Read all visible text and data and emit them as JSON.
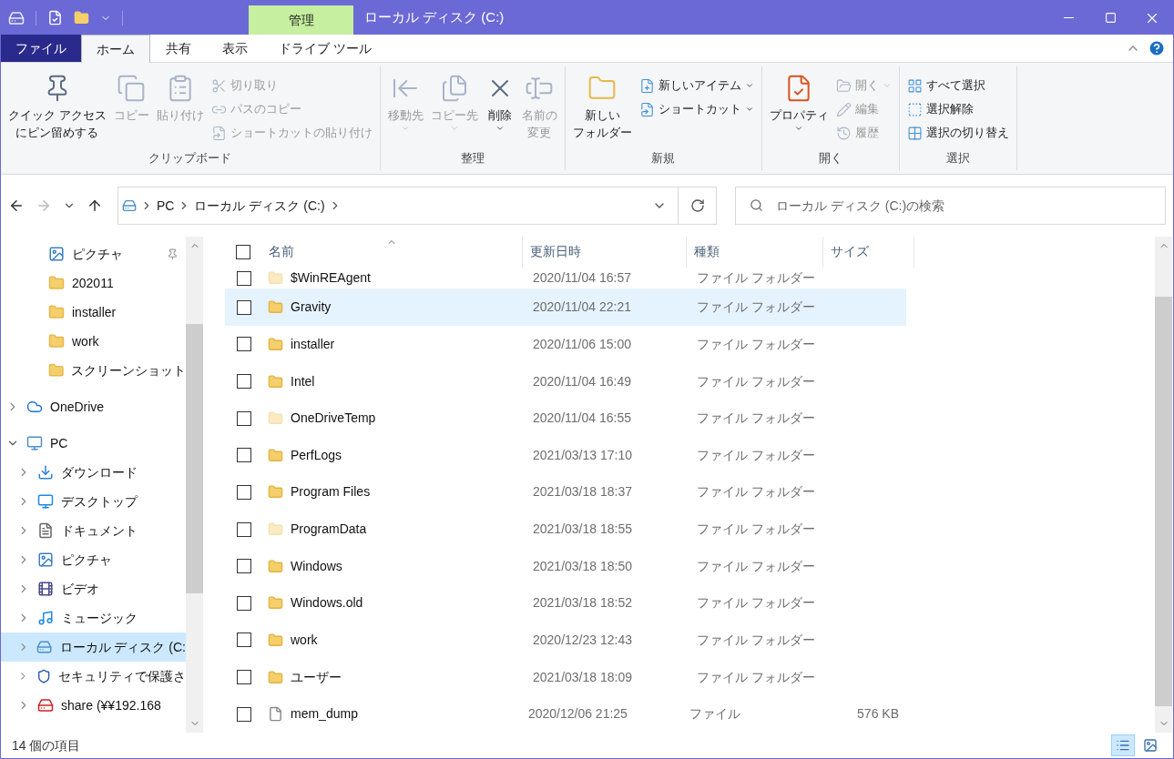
{
  "window": {
    "title": "ローカル ディスク (C:)"
  },
  "ribbon_tabs": [
    {
      "label": "ファイル",
      "kind": "file",
      "selected": false
    },
    {
      "label": "ホーム",
      "kind": "tab",
      "selected": true
    },
    {
      "label": "共有",
      "kind": "tab",
      "selected": false
    },
    {
      "label": "表示",
      "kind": "tab",
      "selected": false
    },
    {
      "label": "ドライブ ツール",
      "kind": "context",
      "context_label": "管理",
      "selected": false
    }
  ],
  "ribbon_groups": [
    {
      "name": "クリップボード",
      "items": [
        {
          "kind": "large",
          "lines": [
            "クイック アクセス",
            "にピン留めする"
          ],
          "disabled": false,
          "dropdown": false
        },
        {
          "kind": "large",
          "lines": [
            "コピー"
          ],
          "disabled": true,
          "dropdown": false
        },
        {
          "kind": "large",
          "lines": [
            "貼り付け"
          ],
          "disabled": true,
          "dropdown": false
        },
        {
          "kind": "small",
          "lines": [
            "切り取り"
          ],
          "disabled": true,
          "dropdown": false
        },
        {
          "kind": "small",
          "lines": [
            "パスのコピー"
          ],
          "disabled": true,
          "dropdown": false
        },
        {
          "kind": "small",
          "lines": [
            "ショートカットの貼り付け"
          ],
          "disabled": true,
          "dropdown": false
        }
      ]
    },
    {
      "name": "整理",
      "items": [
        {
          "kind": "large",
          "lines": [
            "移動先"
          ],
          "disabled": true,
          "dropdown": true
        },
        {
          "kind": "large",
          "lines": [
            "コピー先"
          ],
          "disabled": true,
          "dropdown": true
        },
        {
          "kind": "large",
          "lines": [
            "削除"
          ],
          "disabled": false,
          "dropdown": true
        },
        {
          "kind": "large",
          "lines": [
            "名前の",
            "変更"
          ],
          "disabled": true,
          "dropdown": false
        }
      ]
    },
    {
      "name": "新規",
      "items": [
        {
          "kind": "large",
          "lines": [
            "新しい",
            "フォルダー"
          ],
          "disabled": false,
          "dropdown": false
        },
        {
          "kind": "small",
          "lines": [
            "新しいアイテム"
          ],
          "disabled": false,
          "dropdown": true
        },
        {
          "kind": "small",
          "lines": [
            "ショートカット"
          ],
          "disabled": false,
          "dropdown": true
        }
      ]
    },
    {
      "name": "開く",
      "items": [
        {
          "kind": "large",
          "lines": [
            "プロパティ"
          ],
          "disabled": false,
          "dropdown": true
        },
        {
          "kind": "small",
          "lines": [
            "開く"
          ],
          "disabled": true,
          "dropdown": true
        },
        {
          "kind": "small",
          "lines": [
            "編集"
          ],
          "disabled": true,
          "dropdown": false
        },
        {
          "kind": "small",
          "lines": [
            "履歴"
          ],
          "disabled": true,
          "dropdown": false
        }
      ]
    },
    {
      "name": "選択",
      "items": [
        {
          "kind": "small",
          "lines": [
            "すべて選択"
          ],
          "disabled": false,
          "dropdown": false
        },
        {
          "kind": "small",
          "lines": [
            "選択解除"
          ],
          "disabled": false,
          "dropdown": false
        },
        {
          "kind": "small",
          "lines": [
            "選択の切り替え"
          ],
          "disabled": false,
          "dropdown": false
        }
      ]
    }
  ],
  "address": {
    "crumbs": [
      "PC",
      "ローカル ディスク (C:)"
    ]
  },
  "search": {
    "placeholder": "ローカル ディスク (C:)の検索"
  },
  "sidebar": {
    "quick_access": [
      {
        "label": "ピクチャ",
        "pinned": true
      },
      {
        "label": "202011",
        "pinned": false
      },
      {
        "label": "installer",
        "pinned": false
      },
      {
        "label": "work",
        "pinned": false
      },
      {
        "label": "スクリーンショット",
        "pinned": false
      }
    ],
    "tree": [
      {
        "label": "OneDrive",
        "expanded": false,
        "selected": false
      },
      {
        "label": "PC",
        "expanded": true,
        "selected": false,
        "children": [
          {
            "label": "ダウンロード",
            "expanded": false,
            "selected": false
          },
          {
            "label": "デスクトップ",
            "expanded": false,
            "selected": false
          },
          {
            "label": "ドキュメント",
            "expanded": false,
            "selected": false
          },
          {
            "label": "ピクチャ",
            "expanded": false,
            "selected": false
          },
          {
            "label": "ビデオ",
            "expanded": false,
            "selected": false
          },
          {
            "label": "ミュージック",
            "expanded": false,
            "selected": false
          },
          {
            "label": "ローカル ディスク (C:",
            "expanded": false,
            "selected": true
          },
          {
            "label": "セキュリティで保護さ",
            "expanded": false,
            "selected": false
          },
          {
            "label": "share (¥¥192.168",
            "expanded": false,
            "selected": false
          }
        ]
      }
    ]
  },
  "table": {
    "all_checked": false,
    "columns": [
      {
        "label": "名前",
        "sorted": true
      },
      {
        "label": "更新日時",
        "sorted": false
      },
      {
        "label": "種類",
        "sorted": false
      },
      {
        "label": "サイズ",
        "sorted": false
      }
    ],
    "rows": [
      {
        "name": "$WinREAgent",
        "date": "2020/11/04 16:57",
        "type": "ファイル フォルダー",
        "kind": "folder",
        "hidden": true,
        "checked": false,
        "selected": false
      },
      {
        "name": "Gravity",
        "date": "2020/11/04 22:21",
        "type": "ファイル フォルダー",
        "kind": "folder",
        "hidden": false,
        "checked": false,
        "selected": true
      },
      {
        "name": "installer",
        "date": "2020/11/06 15:00",
        "type": "ファイル フォルダー",
        "kind": "folder",
        "hidden": false,
        "checked": false,
        "selected": false
      },
      {
        "name": "Intel",
        "date": "2020/11/04 16:49",
        "type": "ファイル フォルダー",
        "kind": "folder",
        "hidden": false,
        "checked": false,
        "selected": false
      },
      {
        "name": "OneDriveTemp",
        "date": "2020/11/04 16:55",
        "type": "ファイル フォルダー",
        "kind": "folder",
        "hidden": true,
        "checked": false,
        "selected": false
      },
      {
        "name": "PerfLogs",
        "date": "2021/03/13 17:10",
        "type": "ファイル フォルダー",
        "kind": "folder",
        "hidden": false,
        "checked": false,
        "selected": false
      },
      {
        "name": "Program Files",
        "date": "2021/03/18 18:37",
        "type": "ファイル フォルダー",
        "kind": "folder",
        "hidden": false,
        "checked": false,
        "selected": false
      },
      {
        "name": "ProgramData",
        "date": "2021/03/18 18:55",
        "type": "ファイル フォルダー",
        "kind": "folder",
        "hidden": true,
        "checked": false,
        "selected": false
      },
      {
        "name": "Windows",
        "date": "2021/03/18 18:50",
        "type": "ファイル フォルダー",
        "kind": "folder",
        "hidden": false,
        "checked": false,
        "selected": false
      },
      {
        "name": "Windows.old",
        "date": "2021/03/18 18:52",
        "type": "ファイル フォルダー",
        "kind": "folder",
        "hidden": false,
        "checked": false,
        "selected": false
      },
      {
        "name": "work",
        "date": "2020/12/23 12:43",
        "type": "ファイル フォルダー",
        "kind": "folder",
        "hidden": false,
        "checked": false,
        "selected": false
      },
      {
        "name": "ユーザー",
        "date": "2021/03/18 18:09",
        "type": "ファイル フォルダー",
        "kind": "folder",
        "hidden": false,
        "checked": false,
        "selected": false
      },
      {
        "name": "mem_dump",
        "date": "2020/12/06 21:25",
        "type": "ファイル",
        "size": "576 KB",
        "kind": "file",
        "hidden": false,
        "checked": false,
        "selected": false
      }
    ]
  },
  "status_bar": {
    "count": "14 個の項目",
    "views": [
      {
        "kind": "details",
        "selected": true
      },
      {
        "kind": "large_icons",
        "selected": false
      }
    ]
  }
}
